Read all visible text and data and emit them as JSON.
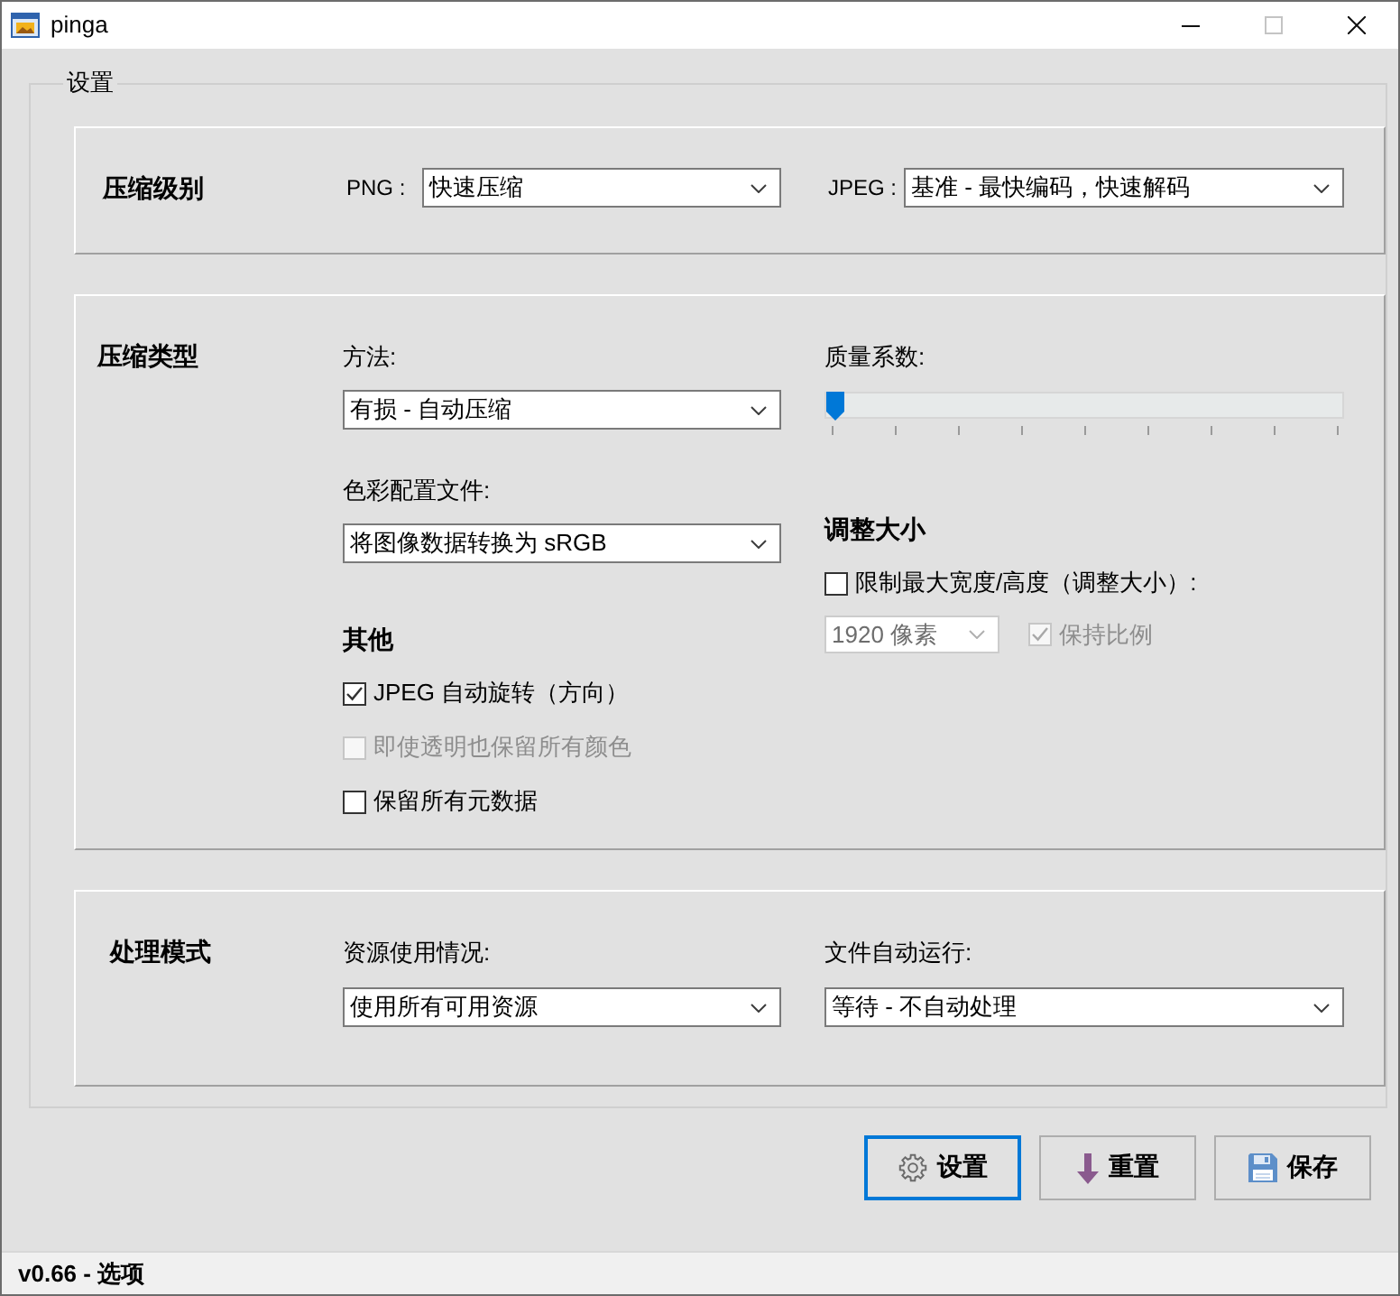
{
  "window": {
    "title": "pinga",
    "controls": [
      {
        "kind": "minimize",
        "disabled": false
      },
      {
        "kind": "maximize",
        "disabled": true
      },
      {
        "kind": "close",
        "disabled": false
      }
    ]
  },
  "settings": {
    "title": "设置",
    "panels": [
      {
        "title": "压缩级别",
        "columns": [
          [
            {
              "kind": "inline_dropdown",
              "label": "PNG :",
              "value": "快速压缩",
              "disabled": false
            }
          ],
          [
            {
              "kind": "inline_dropdown",
              "label": "JPEG :",
              "value": "基准 - 最快编码，快速解码",
              "disabled": false
            }
          ]
        ]
      },
      {
        "title": "压缩类型",
        "columns": [
          [
            {
              "kind": "label",
              "text": "方法:"
            },
            {
              "kind": "dropdown",
              "value": "有损 - 自动压缩",
              "disabled": false
            },
            {
              "kind": "label",
              "text": "色彩配置文件:"
            },
            {
              "kind": "dropdown",
              "value": "将图像数据转换为 sRGB",
              "disabled": false
            },
            {
              "kind": "heading",
              "text": "其他"
            },
            {
              "kind": "checkbox",
              "label": "JPEG 自动旋转（方向）",
              "checked": true,
              "disabled": false
            },
            {
              "kind": "checkbox",
              "label": "即使透明也保留所有颜色",
              "checked": false,
              "disabled": true
            },
            {
              "kind": "checkbox",
              "label": "保留所有元数据",
              "checked": false,
              "disabled": false
            }
          ],
          [
            {
              "kind": "label",
              "text": "质量系数:"
            },
            {
              "kind": "slider",
              "level": 0
            },
            {
              "kind": "heading",
              "text": "调整大小"
            },
            {
              "kind": "checkbox",
              "label": "限制最大宽度/高度（调整大小）:",
              "checked": false,
              "disabled": false
            },
            {
              "kind": "row",
              "items": [
                {
                  "kind": "dropdown",
                  "value": "1920 像素",
                  "disabled": true
                },
                {
                  "kind": "checkbox",
                  "label": "保持比例",
                  "checked": true,
                  "disabled": true
                }
              ]
            }
          ]
        ]
      },
      {
        "title": "处理模式",
        "columns": [
          [
            {
              "kind": "label",
              "text": "资源使用情况:"
            },
            {
              "kind": "dropdown",
              "value": "使用所有可用资源",
              "disabled": false
            }
          ],
          [
            {
              "kind": "label",
              "text": "文件自动运行:"
            },
            {
              "kind": "dropdown",
              "value": "等待 - 不自动处理",
              "disabled": false
            }
          ]
        ]
      }
    ]
  },
  "buttons": [
    {
      "kind": "settings",
      "label": "设置",
      "focused": true
    },
    {
      "kind": "reset",
      "label": "重置",
      "focused": false
    },
    {
      "kind": "save",
      "label": "保存",
      "focused": false
    }
  ],
  "status_bar": {
    "text": "v0.66 - 选项"
  }
}
